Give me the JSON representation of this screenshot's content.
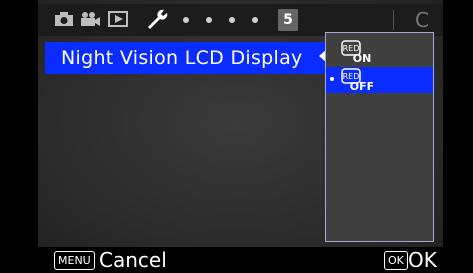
{
  "tabs": [
    {
      "name": "tab-shooting",
      "icon": "camera-icon"
    },
    {
      "name": "tab-movie",
      "icon": "movie-camera-icon"
    },
    {
      "name": "tab-playback",
      "icon": "playback-icon"
    },
    {
      "name": "tab-setup",
      "icon": "wrench-icon"
    }
  ],
  "page_number": "5",
  "custom_tab_label": "C",
  "menu": {
    "item_label": "Night Vision LCD Display"
  },
  "options": [
    {
      "top_text": "RED",
      "bottom_text": "ON",
      "selected": false
    },
    {
      "top_text": "RED",
      "bottom_text": "OFF",
      "selected": true
    }
  ],
  "footer": {
    "menu_key": "MENU",
    "cancel_label": "Cancel",
    "ok_key": "OK",
    "ok_label": "OK"
  },
  "colors": {
    "highlight": "#0b2cff",
    "background": "#2c2c2c"
  }
}
